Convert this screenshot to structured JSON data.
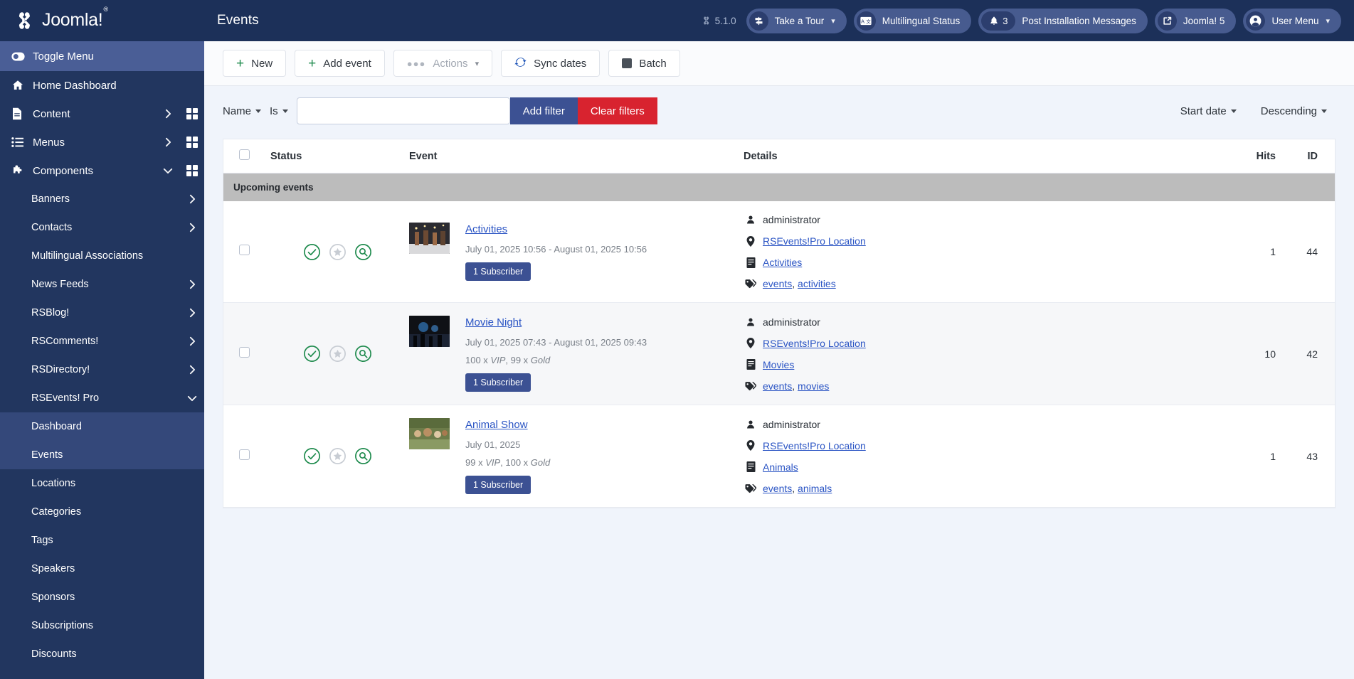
{
  "brand": {
    "name": "Joomla!",
    "registered": "®"
  },
  "header": {
    "page_title": "Events",
    "version_label": "5.1.0",
    "actions": [
      {
        "label": "Take a Tour",
        "icon": "signpost-icon",
        "caret": true
      },
      {
        "label": "Multilingual Status",
        "icon": "language-icon",
        "caret": false
      },
      {
        "label": "Post Installation Messages",
        "icon": "bell-icon",
        "badge": "3",
        "caret": false
      },
      {
        "label": "Joomla! 5",
        "icon": "external-link-icon",
        "caret": false
      },
      {
        "label": "User Menu",
        "icon": "user-circle-icon",
        "caret": true
      }
    ]
  },
  "sidebar": {
    "toggle": {
      "label": "Toggle Menu",
      "icon": "toggle-icon"
    },
    "items": [
      {
        "label": "Home Dashboard",
        "icon": "home-icon",
        "arrow": false,
        "grid": false
      },
      {
        "label": "Content",
        "icon": "document-icon",
        "arrow": "right",
        "grid": true
      },
      {
        "label": "Menus",
        "icon": "list-icon",
        "arrow": "right",
        "grid": true
      },
      {
        "label": "Components",
        "icon": "puzzle-icon",
        "arrow": "down",
        "grid": true
      }
    ],
    "components": [
      {
        "label": "Banners",
        "arrow": "right"
      },
      {
        "label": "Contacts",
        "arrow": "right"
      },
      {
        "label": "Multilingual Associations",
        "arrow": false
      },
      {
        "label": "News Feeds",
        "arrow": "right"
      },
      {
        "label": "RSBlog!",
        "arrow": "right"
      },
      {
        "label": "RSComments!",
        "arrow": "right"
      },
      {
        "label": "RSDirectory!",
        "arrow": "right"
      },
      {
        "label": "RSEvents! Pro",
        "arrow": "down"
      }
    ],
    "rsevents": [
      {
        "label": "Dashboard",
        "active": true
      },
      {
        "label": "Events",
        "active": true
      },
      {
        "label": "Locations",
        "active": false
      },
      {
        "label": "Categories",
        "active": false
      },
      {
        "label": "Tags",
        "active": false
      },
      {
        "label": "Speakers",
        "active": false
      },
      {
        "label": "Sponsors",
        "active": false
      },
      {
        "label": "Subscriptions",
        "active": false
      },
      {
        "label": "Discounts",
        "active": false
      }
    ]
  },
  "toolbar": {
    "new_label": "New",
    "add_event_label": "Add event",
    "actions_label": "Actions",
    "sync_dates_label": "Sync dates",
    "batch_label": "Batch"
  },
  "filters": {
    "field_label": "Name",
    "operator_label": "Is",
    "value": "",
    "placeholder": "",
    "add_filter_label": "Add filter",
    "clear_filters_label": "Clear filters",
    "sort_field_label": "Start date",
    "sort_direction_label": "Descending"
  },
  "table": {
    "headers": {
      "status": "Status",
      "event": "Event",
      "details": "Details",
      "hits": "Hits",
      "id": "ID"
    },
    "group_label": "Upcoming events",
    "rows": [
      {
        "title": "Activities",
        "dates": "July 01, 2025 10:56 - August 01, 2025 10:56",
        "tickets": "",
        "subscribers": "1 Subscriber",
        "author": "administrator",
        "location": "RSEvents!Pro Location",
        "category": "Activities",
        "tags": [
          "events",
          "activities"
        ],
        "hits": "1",
        "id": "44"
      },
      {
        "title": "Movie Night",
        "dates": "July 01, 2025 07:43 - August 01, 2025 09:43",
        "tickets": "100 x VIP , 99 x Gold",
        "tickets_parts": [
          {
            "qty": "100 x ",
            "name": "VIP"
          },
          {
            "qty": ", 99 x ",
            "name": "Gold"
          }
        ],
        "subscribers": "1 Subscriber",
        "author": "administrator",
        "location": "RSEvents!Pro Location",
        "category": "Movies",
        "tags": [
          "events",
          "movies"
        ],
        "hits": "10",
        "id": "42"
      },
      {
        "title": "Animal Show",
        "dates": "July 01, 2025",
        "tickets": "99 x VIP , 100 x Gold",
        "tickets_parts": [
          {
            "qty": "99 x ",
            "name": "VIP"
          },
          {
            "qty": ", 100 x ",
            "name": "Gold"
          }
        ],
        "subscribers": "1 Subscriber",
        "author": "administrator",
        "location": "RSEvents!Pro Location",
        "category": "Animals",
        "tags": [
          "events",
          "animals"
        ],
        "hits": "1",
        "id": "43"
      }
    ]
  },
  "colors": {
    "brand_navy": "#1c3059",
    "sidebar": "#22365f",
    "accent_blue": "#3c5193",
    "danger_red": "#d8232f",
    "link_blue": "#2a54c4",
    "status_green": "#1d8a4c"
  }
}
